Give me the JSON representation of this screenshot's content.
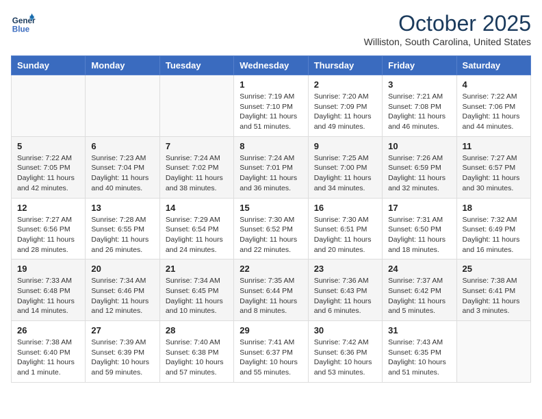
{
  "header": {
    "logo_line1": "General",
    "logo_line2": "Blue",
    "month": "October 2025",
    "location": "Williston, South Carolina, United States"
  },
  "weekdays": [
    "Sunday",
    "Monday",
    "Tuesday",
    "Wednesday",
    "Thursday",
    "Friday",
    "Saturday"
  ],
  "weeks": [
    [
      {
        "day": "",
        "sunrise": "",
        "sunset": "",
        "daylight": ""
      },
      {
        "day": "",
        "sunrise": "",
        "sunset": "",
        "daylight": ""
      },
      {
        "day": "",
        "sunrise": "",
        "sunset": "",
        "daylight": ""
      },
      {
        "day": "1",
        "sunrise": "Sunrise: 7:19 AM",
        "sunset": "Sunset: 7:10 PM",
        "daylight": "Daylight: 11 hours and 51 minutes."
      },
      {
        "day": "2",
        "sunrise": "Sunrise: 7:20 AM",
        "sunset": "Sunset: 7:09 PM",
        "daylight": "Daylight: 11 hours and 49 minutes."
      },
      {
        "day": "3",
        "sunrise": "Sunrise: 7:21 AM",
        "sunset": "Sunset: 7:08 PM",
        "daylight": "Daylight: 11 hours and 46 minutes."
      },
      {
        "day": "4",
        "sunrise": "Sunrise: 7:22 AM",
        "sunset": "Sunset: 7:06 PM",
        "daylight": "Daylight: 11 hours and 44 minutes."
      }
    ],
    [
      {
        "day": "5",
        "sunrise": "Sunrise: 7:22 AM",
        "sunset": "Sunset: 7:05 PM",
        "daylight": "Daylight: 11 hours and 42 minutes."
      },
      {
        "day": "6",
        "sunrise": "Sunrise: 7:23 AM",
        "sunset": "Sunset: 7:04 PM",
        "daylight": "Daylight: 11 hours and 40 minutes."
      },
      {
        "day": "7",
        "sunrise": "Sunrise: 7:24 AM",
        "sunset": "Sunset: 7:02 PM",
        "daylight": "Daylight: 11 hours and 38 minutes."
      },
      {
        "day": "8",
        "sunrise": "Sunrise: 7:24 AM",
        "sunset": "Sunset: 7:01 PM",
        "daylight": "Daylight: 11 hours and 36 minutes."
      },
      {
        "day": "9",
        "sunrise": "Sunrise: 7:25 AM",
        "sunset": "Sunset: 7:00 PM",
        "daylight": "Daylight: 11 hours and 34 minutes."
      },
      {
        "day": "10",
        "sunrise": "Sunrise: 7:26 AM",
        "sunset": "Sunset: 6:59 PM",
        "daylight": "Daylight: 11 hours and 32 minutes."
      },
      {
        "day": "11",
        "sunrise": "Sunrise: 7:27 AM",
        "sunset": "Sunset: 6:57 PM",
        "daylight": "Daylight: 11 hours and 30 minutes."
      }
    ],
    [
      {
        "day": "12",
        "sunrise": "Sunrise: 7:27 AM",
        "sunset": "Sunset: 6:56 PM",
        "daylight": "Daylight: 11 hours and 28 minutes."
      },
      {
        "day": "13",
        "sunrise": "Sunrise: 7:28 AM",
        "sunset": "Sunset: 6:55 PM",
        "daylight": "Daylight: 11 hours and 26 minutes."
      },
      {
        "day": "14",
        "sunrise": "Sunrise: 7:29 AM",
        "sunset": "Sunset: 6:54 PM",
        "daylight": "Daylight: 11 hours and 24 minutes."
      },
      {
        "day": "15",
        "sunrise": "Sunrise: 7:30 AM",
        "sunset": "Sunset: 6:52 PM",
        "daylight": "Daylight: 11 hours and 22 minutes."
      },
      {
        "day": "16",
        "sunrise": "Sunrise: 7:30 AM",
        "sunset": "Sunset: 6:51 PM",
        "daylight": "Daylight: 11 hours and 20 minutes."
      },
      {
        "day": "17",
        "sunrise": "Sunrise: 7:31 AM",
        "sunset": "Sunset: 6:50 PM",
        "daylight": "Daylight: 11 hours and 18 minutes."
      },
      {
        "day": "18",
        "sunrise": "Sunrise: 7:32 AM",
        "sunset": "Sunset: 6:49 PM",
        "daylight": "Daylight: 11 hours and 16 minutes."
      }
    ],
    [
      {
        "day": "19",
        "sunrise": "Sunrise: 7:33 AM",
        "sunset": "Sunset: 6:48 PM",
        "daylight": "Daylight: 11 hours and 14 minutes."
      },
      {
        "day": "20",
        "sunrise": "Sunrise: 7:34 AM",
        "sunset": "Sunset: 6:46 PM",
        "daylight": "Daylight: 11 hours and 12 minutes."
      },
      {
        "day": "21",
        "sunrise": "Sunrise: 7:34 AM",
        "sunset": "Sunset: 6:45 PM",
        "daylight": "Daylight: 11 hours and 10 minutes."
      },
      {
        "day": "22",
        "sunrise": "Sunrise: 7:35 AM",
        "sunset": "Sunset: 6:44 PM",
        "daylight": "Daylight: 11 hours and 8 minutes."
      },
      {
        "day": "23",
        "sunrise": "Sunrise: 7:36 AM",
        "sunset": "Sunset: 6:43 PM",
        "daylight": "Daylight: 11 hours and 6 minutes."
      },
      {
        "day": "24",
        "sunrise": "Sunrise: 7:37 AM",
        "sunset": "Sunset: 6:42 PM",
        "daylight": "Daylight: 11 hours and 5 minutes."
      },
      {
        "day": "25",
        "sunrise": "Sunrise: 7:38 AM",
        "sunset": "Sunset: 6:41 PM",
        "daylight": "Daylight: 11 hours and 3 minutes."
      }
    ],
    [
      {
        "day": "26",
        "sunrise": "Sunrise: 7:38 AM",
        "sunset": "Sunset: 6:40 PM",
        "daylight": "Daylight: 11 hours and 1 minute."
      },
      {
        "day": "27",
        "sunrise": "Sunrise: 7:39 AM",
        "sunset": "Sunset: 6:39 PM",
        "daylight": "Daylight: 10 hours and 59 minutes."
      },
      {
        "day": "28",
        "sunrise": "Sunrise: 7:40 AM",
        "sunset": "Sunset: 6:38 PM",
        "daylight": "Daylight: 10 hours and 57 minutes."
      },
      {
        "day": "29",
        "sunrise": "Sunrise: 7:41 AM",
        "sunset": "Sunset: 6:37 PM",
        "daylight": "Daylight: 10 hours and 55 minutes."
      },
      {
        "day": "30",
        "sunrise": "Sunrise: 7:42 AM",
        "sunset": "Sunset: 6:36 PM",
        "daylight": "Daylight: 10 hours and 53 minutes."
      },
      {
        "day": "31",
        "sunrise": "Sunrise: 7:43 AM",
        "sunset": "Sunset: 6:35 PM",
        "daylight": "Daylight: 10 hours and 51 minutes."
      },
      {
        "day": "",
        "sunrise": "",
        "sunset": "",
        "daylight": ""
      }
    ]
  ]
}
